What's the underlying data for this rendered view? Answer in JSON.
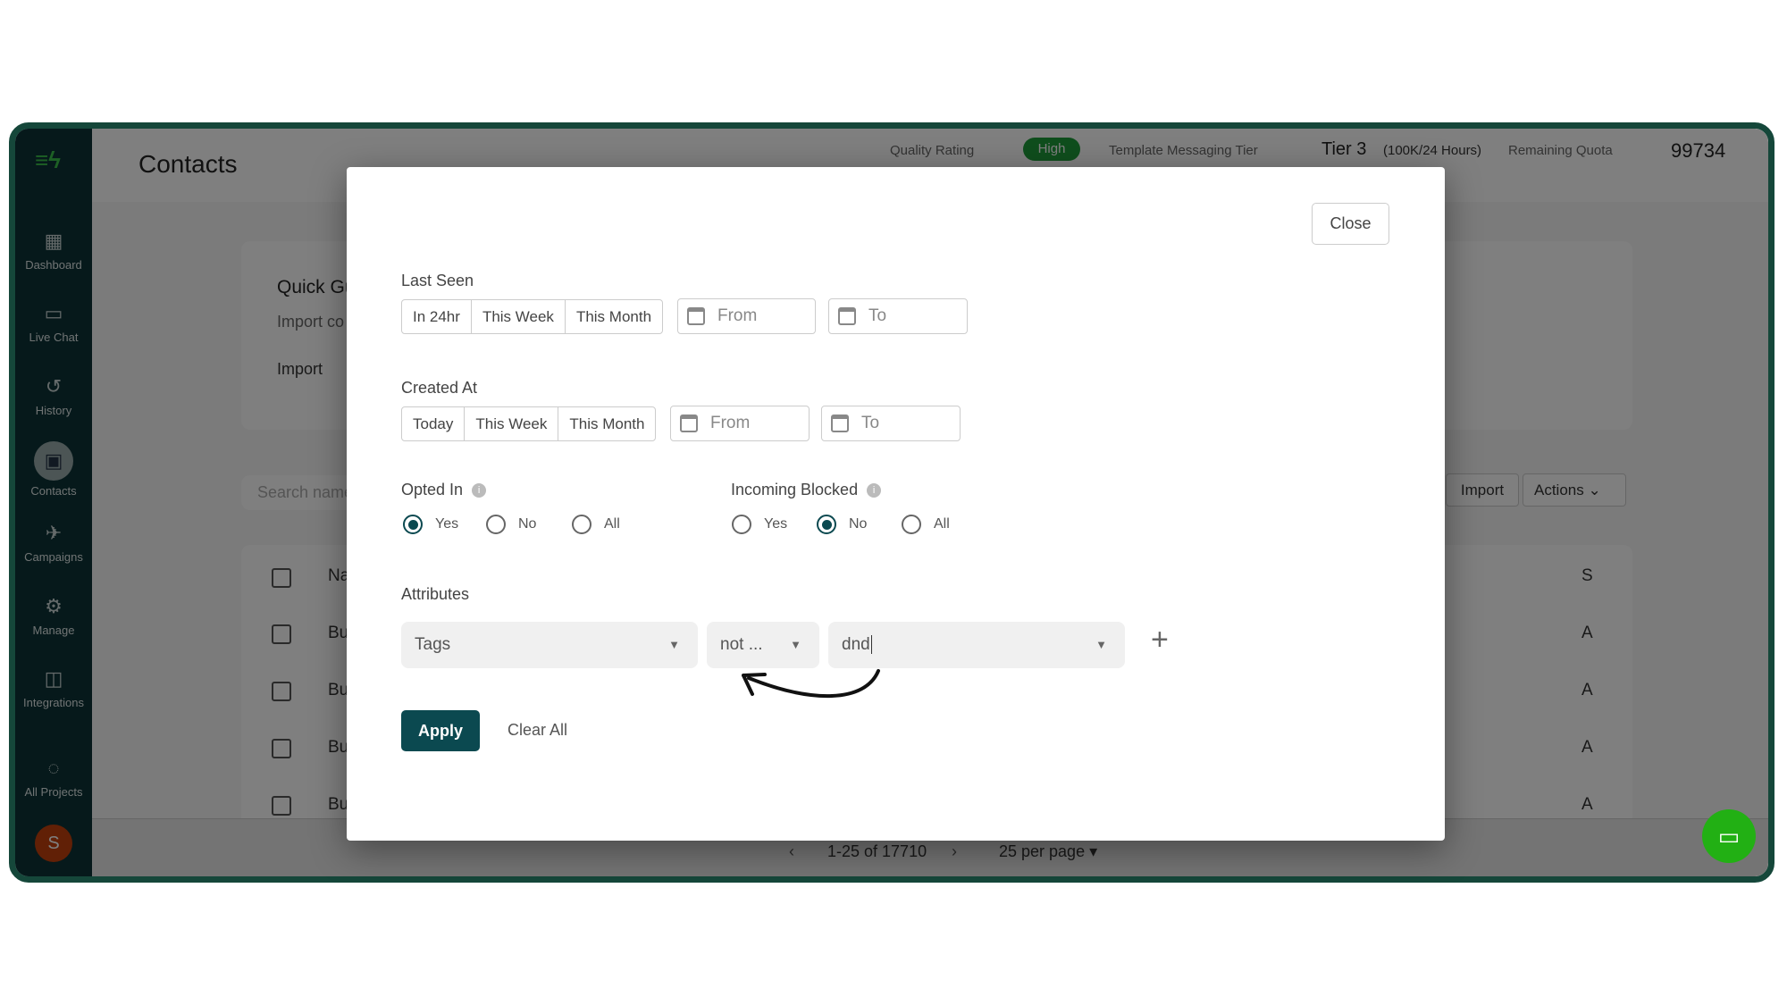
{
  "sidebar": {
    "items": [
      {
        "label": "Dashboard",
        "icon": "dashboard-icon"
      },
      {
        "label": "Live Chat",
        "icon": "chat-icon"
      },
      {
        "label": "History",
        "icon": "history-icon"
      },
      {
        "label": "Contacts",
        "icon": "contacts-icon",
        "active": true
      },
      {
        "label": "Campaigns",
        "icon": "campaign-icon"
      },
      {
        "label": "Manage",
        "icon": "gear-icon"
      },
      {
        "label": "Integrations",
        "icon": "integrations-icon"
      },
      {
        "label": "All Projects",
        "icon": "projects-icon"
      }
    ],
    "avatar": "S"
  },
  "header": {
    "title": "Contacts",
    "quality_label": "Quality Rating",
    "quality_value": "High",
    "tier_label": "Template Messaging Tier",
    "tier_value": "Tier 3",
    "tier_detail": "(100K/24 Hours)",
    "quota_label": "Remaining Quota",
    "quota_value": "99734"
  },
  "background": {
    "guide_title": "Quick Gu",
    "guide_text": "Import co",
    "guide_link": "Import",
    "search_placeholder": "Search name",
    "import": "Import",
    "actions": "Actions",
    "col_name": "Na",
    "col_s": "S",
    "row_names": [
      "Bul",
      "Bul",
      "Bul",
      "Bul"
    ],
    "row_s": [
      "A",
      "A",
      "A",
      "A"
    ],
    "pagination": "1-25 of 17710",
    "per_page": "25 per page"
  },
  "modal": {
    "close": "Close",
    "last_seen": {
      "label": "Last Seen",
      "options": [
        "In 24hr",
        "This Week",
        "This Month"
      ],
      "from": "From",
      "to": "To"
    },
    "created_at": {
      "label": "Created At",
      "options": [
        "Today",
        "This Week",
        "This Month"
      ],
      "from": "From",
      "to": "To"
    },
    "opted_in": {
      "label": "Opted In",
      "options": [
        "Yes",
        "No",
        "All"
      ],
      "selected": "Yes"
    },
    "incoming_blocked": {
      "label": "Incoming Blocked",
      "options": [
        "Yes",
        "No",
        "All"
      ],
      "selected": "No"
    },
    "attributes": {
      "label": "Attributes",
      "field": "Tags",
      "operator": "not ...",
      "value": "dnd"
    },
    "apply": "Apply",
    "clear_all": "Clear All"
  },
  "colors": {
    "frame": "#15473a",
    "sidebar": "#0c3336",
    "primary": "#0b4950",
    "badge": "#1f9d3a",
    "chat": "#22b014"
  }
}
